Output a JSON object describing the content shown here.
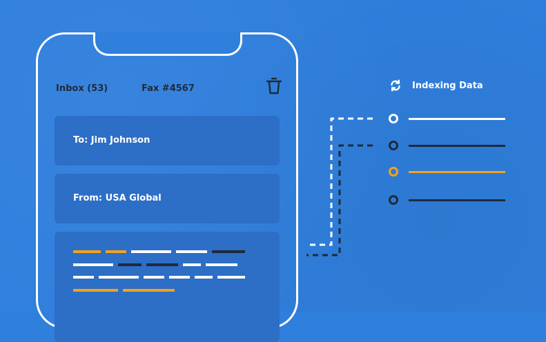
{
  "phone": {
    "inbox_label": "Inbox (53)",
    "fax_label": "Fax #4567",
    "to_text": "To: Jim Johnson",
    "from_text": "From:  USA Global"
  },
  "indexing": {
    "label": "Indexing Data",
    "rows": [
      {
        "color": "#ffffff"
      },
      {
        "color": "#1f2a3a"
      },
      {
        "color": "#f5a21a"
      },
      {
        "color": "#1f2a3a"
      }
    ]
  },
  "colors": {
    "background": "#2f7fdd",
    "card": "#2d6ec6",
    "accent": "#f5a21a",
    "dark": "#1f2a3a",
    "white": "#ffffff"
  },
  "icons": {
    "trash": "trash-icon",
    "refresh": "refresh-icon"
  }
}
